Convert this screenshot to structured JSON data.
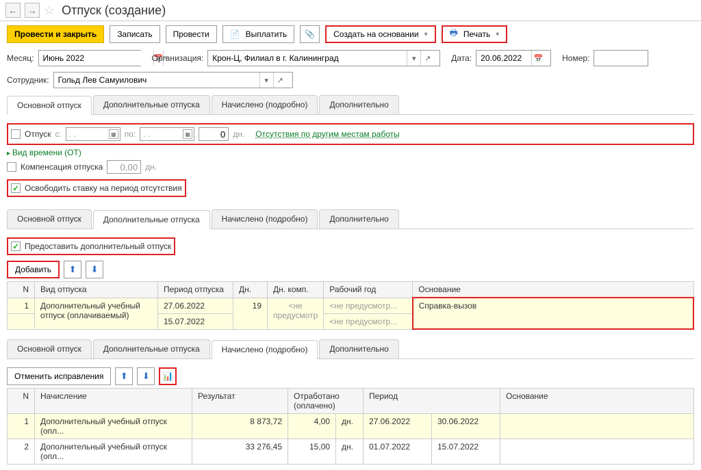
{
  "titlebar": {
    "title": "Отпуск (создание)"
  },
  "toolbar": {
    "save_close": "Провести и закрыть",
    "write": "Записать",
    "post": "Провести",
    "pay": "Выплатить",
    "create_based": "Создать на основании",
    "print": "Печать"
  },
  "form": {
    "month_label": "Месяц:",
    "month_value": "Июнь 2022",
    "org_label": "Организация:",
    "org_value": "Крон-Ц, Филиал в г. Калининград",
    "date_label": "Дата:",
    "date_value": "20.06.2022",
    "number_label": "Номер:",
    "employee_label": "Сотрудник:",
    "employee_value": "Гольд Лев Самуилович"
  },
  "tabs1": {
    "main": "Основной отпуск",
    "extra": "Дополнительные отпуска",
    "calc": "Начислено (подробно)",
    "more": "Дополнительно"
  },
  "main_tab": {
    "vacation_label": "Отпуск",
    "from_label": "с:",
    "to_label": "по:",
    "days_zero": "0",
    "days_label": "дн.",
    "absence_link": "Отсутствия по другим местам работы",
    "time_type": "Вид времени (ОТ)",
    "comp_label": "Компенсация отпуска",
    "comp_val": "0,00",
    "comp_days": "дн.",
    "release_label": "Освободить ставку на период отсутствия"
  },
  "extra_tab": {
    "provide": "Предоставить дополнительный отпуск",
    "add": "Добавить",
    "cols": {
      "n": "N",
      "type": "Вид отпуска",
      "period": "Период отпуска",
      "days": "Дн.",
      "comp": "Дн. комп.",
      "year": "Рабочий год",
      "reason": "Основание"
    },
    "row1": {
      "n": "1",
      "type": "Дополнительный учебный отпуск (оплачиваемый)",
      "d1": "27.06.2022",
      "d2": "15.07.2022",
      "days": "19",
      "comp": "<не предусмотр",
      "year1": "<не предусмотр...",
      "year2": "<не предусмотр...",
      "reason": "Справка-вызов"
    }
  },
  "calc_tab": {
    "cancel": "Отменить исправления",
    "cols": {
      "n": "N",
      "name": "Начисление",
      "result": "Результат",
      "worked": "Отработано (оплачено)",
      "period": "Период",
      "reason": "Основание"
    },
    "rows": [
      {
        "n": "1",
        "name": "Дополнительный учебный отпуск (опл...",
        "result": "8 873,72",
        "worked": "4,00",
        "unit": "дн.",
        "p1": "27.06.2022",
        "p2": "30.06.2022"
      },
      {
        "n": "2",
        "name": "Дополнительный учебный отпуск (опл...",
        "result": "33 276,45",
        "worked": "15,00",
        "unit": "дн.",
        "p1": "01.07.2022",
        "p2": "15.07.2022"
      }
    ]
  }
}
